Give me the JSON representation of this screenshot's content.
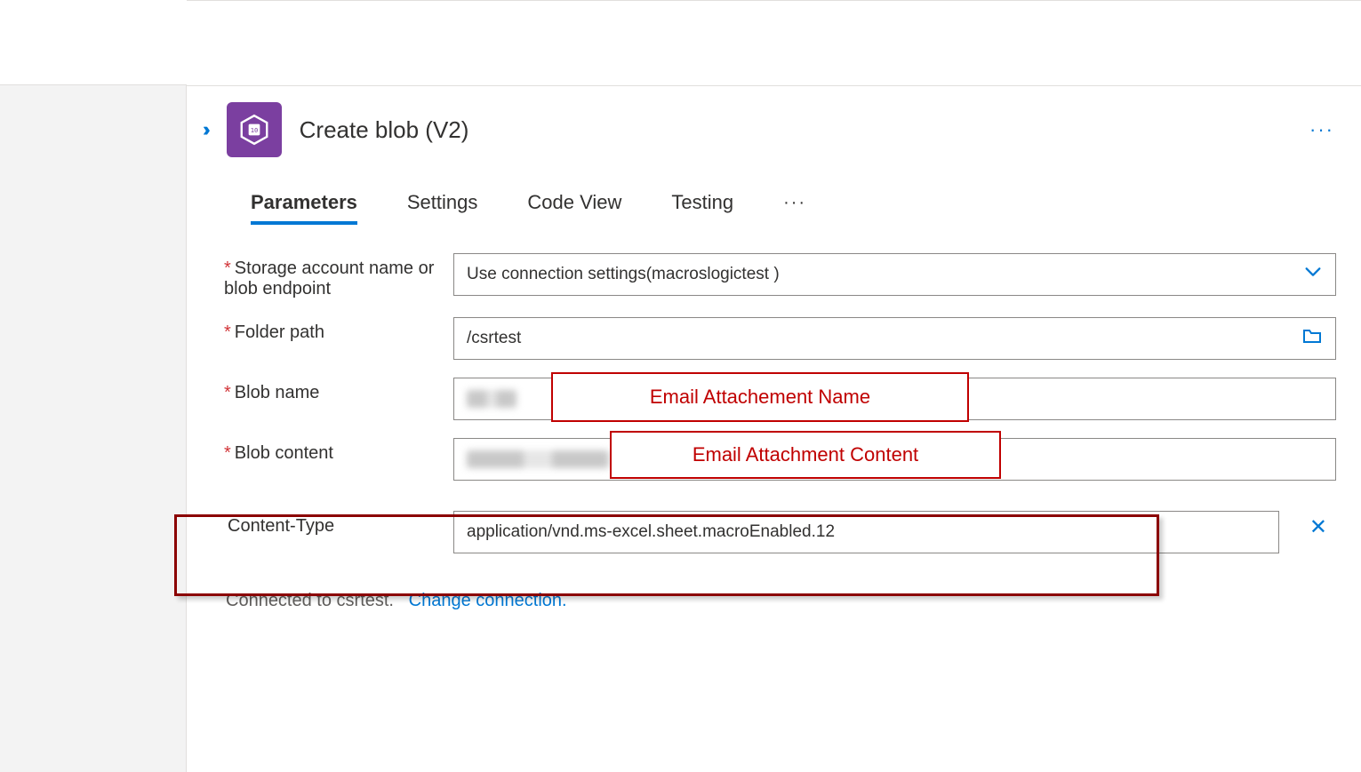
{
  "header": {
    "title": "Create blob (V2)"
  },
  "tabs": {
    "items": [
      "Parameters",
      "Settings",
      "Code View",
      "Testing"
    ],
    "active": 0
  },
  "fields": {
    "storage_label": "Storage account name or blob endpoint",
    "storage_value": "Use connection settings(macroslogictest )",
    "folder_label": "Folder path",
    "folder_value": "/csrtest",
    "blobname_label": "Blob name",
    "blobcontent_label": "Blob content",
    "contenttype_label": "Content-Type",
    "contenttype_value": "application/vnd.ms-excel.sheet.macroEnabled.12"
  },
  "annotations": {
    "blobname": "Email Attachement Name",
    "blobcontent": "Email Attachment Content"
  },
  "footer": {
    "connected_text": "Connected to csrtest.",
    "change_link": "Change connection."
  }
}
